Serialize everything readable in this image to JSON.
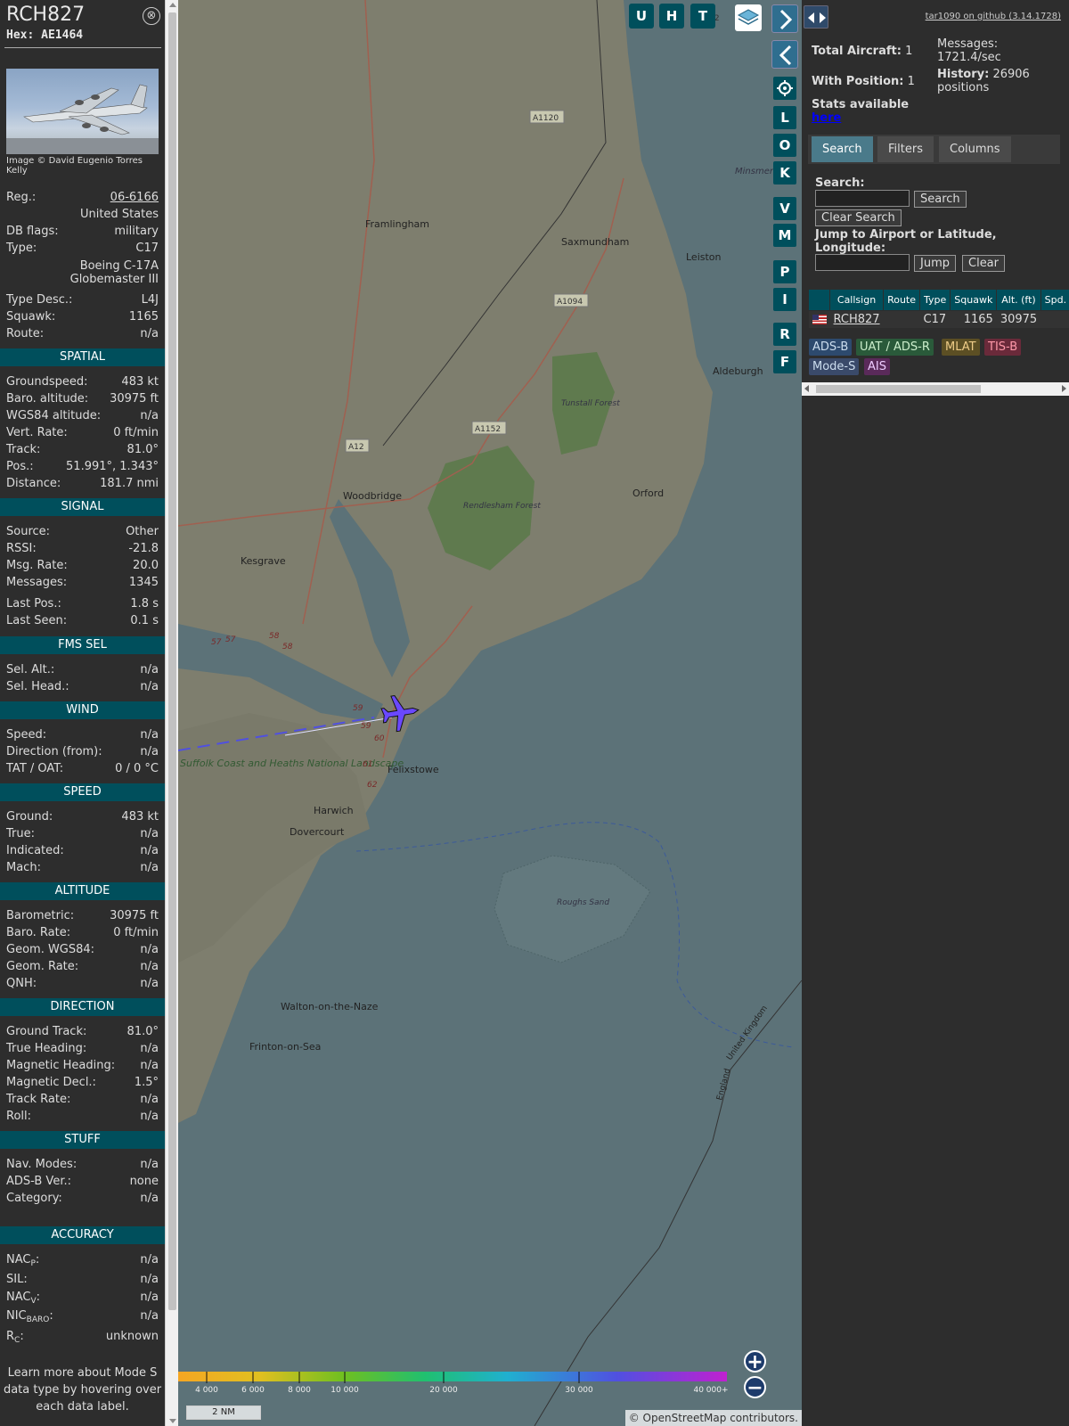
{
  "aircraft": {
    "callsign": "RCH827",
    "hex_label": "Hex:",
    "hex": "AE1464",
    "close_glyph": "⊗",
    "photo_credit": "Image © David Eugenio Torres Kelly",
    "reg_label": "Reg.:",
    "reg": "06-6166",
    "country": "United States",
    "dbflags_label": "DB flags:",
    "dbflags": "military",
    "type_label": "Type:",
    "type": "C17",
    "type_full": "Boeing C-17A Globemaster III",
    "typedesc_label": "Type Desc.:",
    "typedesc": "L4J",
    "squawk_label": "Squawk:",
    "squawk": "1165",
    "route_label": "Route:",
    "route": "n/a"
  },
  "spatial": {
    "title": "SPATIAL",
    "rows": [
      {
        "label": "Groundspeed:",
        "value": "483 kt"
      },
      {
        "label": "Baro. altitude:",
        "value": "30975 ft"
      },
      {
        "label": "WGS84 altitude:",
        "value": "n/a"
      },
      {
        "label": "Vert. Rate:",
        "value": "0 ft/min"
      },
      {
        "label": "Track:",
        "value": "81.0°"
      },
      {
        "label": "Pos.:",
        "value": "51.991°, 1.343°"
      },
      {
        "label": "Distance:",
        "value": "181.7 nmi"
      }
    ]
  },
  "signal": {
    "title": "SIGNAL",
    "rows": [
      {
        "label": "Source:",
        "value": "Other"
      },
      {
        "label": "RSSI:",
        "value": "-21.8"
      },
      {
        "label": "Msg. Rate:",
        "value": "20.0"
      },
      {
        "label": "Messages:",
        "value": "1345"
      },
      {
        "label": "Last Pos.:",
        "value": "1.8 s"
      },
      {
        "label": "Last Seen:",
        "value": "0.1 s"
      }
    ]
  },
  "fms": {
    "title": "FMS SEL",
    "rows": [
      {
        "label": "Sel. Alt.:",
        "value": "n/a"
      },
      {
        "label": "Sel. Head.:",
        "value": "n/a"
      }
    ]
  },
  "wind": {
    "title": "WIND",
    "rows": [
      {
        "label": "Speed:",
        "value": "n/a"
      },
      {
        "label": "Direction (from):",
        "value": "n/a"
      },
      {
        "label": "TAT / OAT:",
        "value": "0 / 0 °C"
      }
    ]
  },
  "speed": {
    "title": "SPEED",
    "rows": [
      {
        "label": "Ground:",
        "value": "483 kt"
      },
      {
        "label": "True:",
        "value": "n/a"
      },
      {
        "label": "Indicated:",
        "value": "n/a"
      },
      {
        "label": "Mach:",
        "value": "n/a"
      }
    ]
  },
  "altitude": {
    "title": "ALTITUDE",
    "rows": [
      {
        "label": "Barometric:",
        "value": "30975 ft"
      },
      {
        "label": "Baro. Rate:",
        "value": "0 ft/min"
      },
      {
        "label": "Geom. WGS84:",
        "value": "n/a"
      },
      {
        "label": "Geom. Rate:",
        "value": "n/a"
      },
      {
        "label": "QNH:",
        "value": "n/a"
      }
    ]
  },
  "direction": {
    "title": "DIRECTION",
    "rows": [
      {
        "label": "Ground Track:",
        "value": "81.0°"
      },
      {
        "label": "True Heading:",
        "value": "n/a"
      },
      {
        "label": "Magnetic Heading:",
        "value": "n/a"
      },
      {
        "label": "Magnetic Decl.:",
        "value": "1.5°"
      },
      {
        "label": "Track Rate:",
        "value": "n/a"
      },
      {
        "label": "Roll:",
        "value": "n/a"
      }
    ]
  },
  "stuff": {
    "title": "STUFF",
    "rows": [
      {
        "label": "Nav. Modes:",
        "value": "n/a"
      },
      {
        "label": "ADS-B Ver.:",
        "value": "none"
      },
      {
        "label": "Category:",
        "value": "n/a"
      }
    ]
  },
  "accuracy": {
    "title": "ACCURACY",
    "nacp_main": "NAC",
    "nacp_sub": "P",
    "nacp_value": "n/a",
    "sil_label": "SIL:",
    "sil_value": "n/a",
    "nacv_main": "NAC",
    "nacv_sub": "V",
    "nacv_value": "n/a",
    "nicbaro_main": "NIC",
    "nicbaro_sub": "BARO",
    "nicbaro_value": "n/a",
    "rc_main": "R",
    "rc_sub": "C",
    "rc_value": "unknown",
    "colon": ":"
  },
  "footer_note": "Learn more about Mode S data type by hovering over each data label.",
  "map": {
    "buttons_top": [
      "U",
      "H",
      "T"
    ],
    "buttons_side": [
      "L",
      "O",
      "K",
      "V",
      "M",
      "P",
      "I",
      "R",
      "F"
    ],
    "places": [
      {
        "name": "Framlingham"
      },
      {
        "name": "Saxmundham"
      },
      {
        "name": "Leiston"
      },
      {
        "name": "Minsmere"
      },
      {
        "name": "Aldeburgh"
      },
      {
        "name": "Tunstall Forest"
      },
      {
        "name": "Woodbridge"
      },
      {
        "name": "Rendlesham Forest"
      },
      {
        "name": "Orford"
      },
      {
        "name": "Kesgrave"
      },
      {
        "name": "Felixstowe"
      },
      {
        "name": "Harwich"
      },
      {
        "name": "Dovercourt"
      },
      {
        "name": "Roughs Sand"
      },
      {
        "name": "Walton-on-the-Naze"
      },
      {
        "name": "Frinton-on-Sea"
      },
      {
        "name": "United Kingdom"
      },
      {
        "name": "England"
      },
      {
        "name": "Suffolk Coast and Heaths National Landscape"
      }
    ],
    "roads": [
      "A1120",
      "A1094",
      "A1152",
      "A12",
      "A12"
    ],
    "junctions": [
      "58",
      "58",
      "57",
      "57",
      "59",
      "59",
      "60",
      "61",
      "62"
    ],
    "altitude_ticks": [
      "4 000",
      "6 000",
      "8 000",
      "10 000",
      "20 000",
      "30 000",
      "40 000+"
    ],
    "scale_label": "2 NM",
    "attribution_prefix": "© ",
    "attribution_link": "OpenStreetMap",
    "attribution_suffix": " contributors.",
    "zoom_in": "+",
    "zoom_out": "−"
  },
  "stats": {
    "github_link": "tar1090 on github (3.14.1728)",
    "total_label": "Total Aircraft:",
    "total_value": "1",
    "withpos_label": "With Position:",
    "withpos_value": "1",
    "messages_label": "Messages:",
    "messages_value": "1721.4/sec",
    "history_label": "History:",
    "history_value": "26906 positions",
    "stats_text": "Stats available",
    "stats_link": "here"
  },
  "tabs": [
    "Search",
    "Filters",
    "Columns"
  ],
  "search": {
    "label": "Search:",
    "search_button": "Search",
    "clear_button": "Clear Search",
    "jump_label": "Jump to Airport or Latitude, Longitude:",
    "jump_button": "Jump",
    "jump_clear_button": "Clear"
  },
  "table": {
    "headers": [
      "",
      "Callsign",
      "Route",
      "Type",
      "Squawk",
      "Alt. (ft)",
      "Spd."
    ],
    "rows": [
      {
        "callsign": "RCH827",
        "route": "",
        "type": "C17",
        "squawk": "1165",
        "alt": "30975",
        "spd": ""
      }
    ]
  },
  "legend": [
    {
      "label": "ADS-B",
      "bg": "#2d4a6e"
    },
    {
      "label": "UAT / ADS-R",
      "bg": "#2a5a3a"
    },
    {
      "label": "MLAT",
      "bg": "#5c4f24"
    },
    {
      "label": "TIS-B",
      "bg": "#6a2a3a"
    },
    {
      "label": "Mode-S",
      "bg": "#3a4a6a"
    },
    {
      "label": "AIS",
      "bg": "#5a2a5a"
    }
  ],
  "colors": {
    "section_bg": "#004f5c",
    "aircraft_icon": "#6a48ff",
    "track_line": "#5050e0"
  }
}
